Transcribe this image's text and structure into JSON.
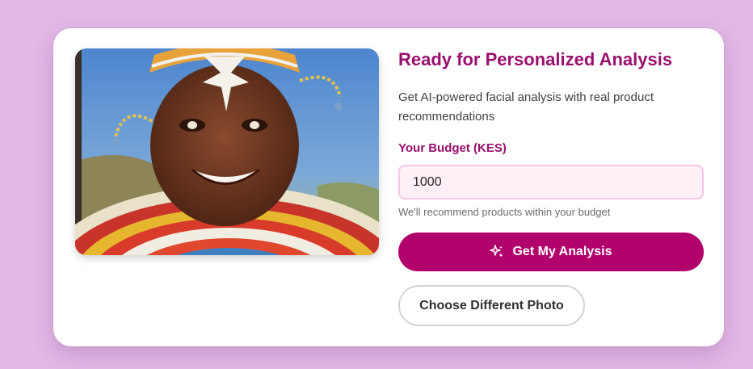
{
  "colors": {
    "background": "#e2b8e6",
    "accent": "#9a0f6e",
    "primary_button": "#b1006b",
    "input_background": "#fdf0f7",
    "input_border": "#f7c6e3"
  },
  "photo": {
    "icon": "uploaded-face-photo"
  },
  "heading": {
    "title": "Ready for Personalized Analysis",
    "subtitle": "Get AI-powered facial analysis with real product recommendations"
  },
  "budget": {
    "label": "Your Budget (KES)",
    "value": "1000",
    "hint": "We'll recommend products within your budget"
  },
  "actions": {
    "analysis_label": "Get My Analysis",
    "analysis_icon": "sparkles-icon",
    "choose_label": "Choose Different Photo"
  }
}
